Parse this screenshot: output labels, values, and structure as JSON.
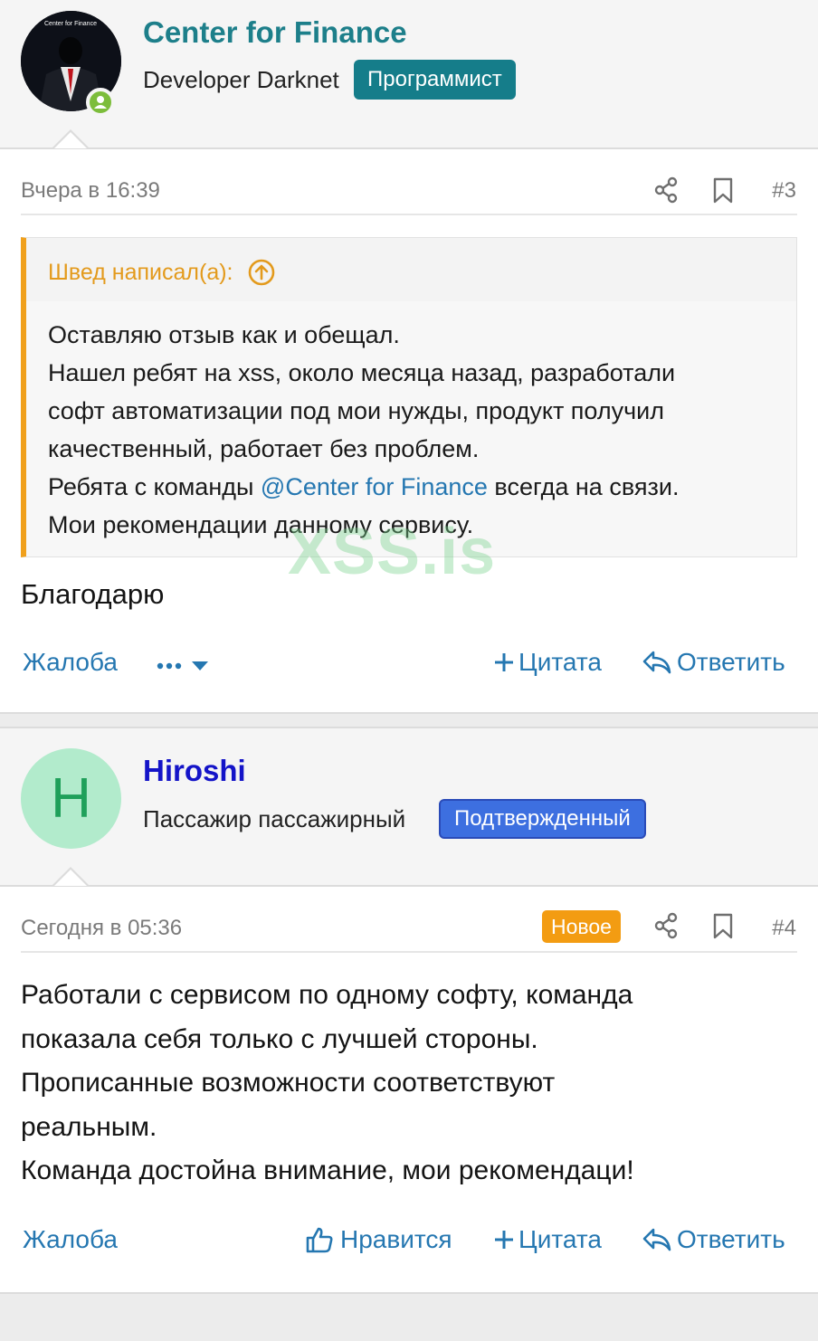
{
  "posts": [
    {
      "author": "Center for Finance",
      "author_color": "#1d7f8a",
      "user_title": "Developer Darknet",
      "badge": "Программист",
      "badge_color": "#157d8a",
      "avatar_text": "Center for Finance",
      "date": "Вчера в 16:39",
      "number": "#3",
      "quote": {
        "author": "Швед написал(а):",
        "lines": [
          "Оставляю отзыв как и обещал.",
          "Нашел ребят на xss, около месяца назад, разработали",
          "софт автоматизации под мои нужды, продукт получил",
          "качественный, работает без проблем."
        ],
        "line5_before": "Ребята с команды ",
        "line5_mention": "@Center for Finance",
        "line5_after": " всегда на связи.",
        "line6": "Мои рекомендации данному сервису."
      },
      "body": "Благодарю",
      "actions": {
        "report": "Жалоба",
        "quote": "Цитата",
        "reply": "Ответить"
      }
    },
    {
      "author": "Hiroshi",
      "author_color": "#1414c8",
      "user_title": "Пассажир пассажирный",
      "badge": "Подтвержденный",
      "badge_color": "#3d6fe0",
      "avatar_letter": "H",
      "date": "Сегодня в 05:36",
      "new_label": "Новое",
      "number": "#4",
      "body_lines": [
        "Работали с сервисом по одному софту, команда",
        "показала себя только с лучшей стороны.",
        "Прописанные возможности соответствуют",
        "реальным.",
        "Команда достойна внимание, мои рекомендаци!"
      ],
      "actions": {
        "report": "Жалоба",
        "like": "Нравится",
        "quote": "Цитата",
        "reply": "Ответить"
      }
    }
  ],
  "watermark": "XSS.is"
}
